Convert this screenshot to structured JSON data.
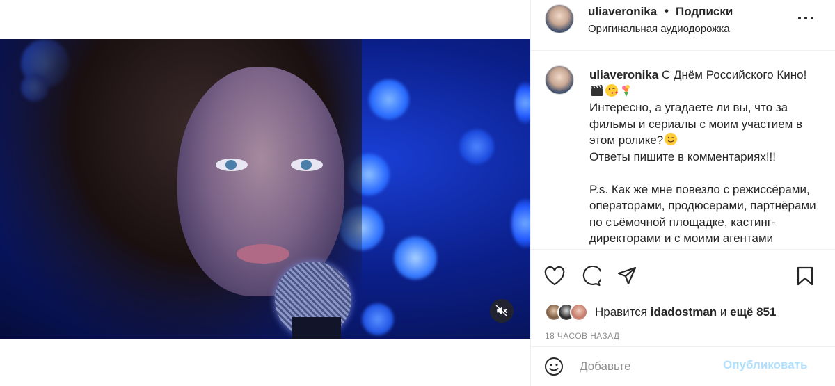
{
  "post": {
    "username": "uliaveronika",
    "dot": "•",
    "follow_label": "Подписки",
    "audio_label": "Оригинальная аудиодорожка",
    "caption": {
      "username": "uliaveronika",
      "line1": " С Днём Российского Кино!",
      "line2": "Интересно, а угадаете ли вы, что за фильмы и сериалы с моим участием в этом ролике?",
      "line3": "Ответы пишите в комментариях!!!",
      "line4": "P.s. Как же мне повезло с режиссёрами, операторами, продюсерами, партнёрами по съёмочной площадке, кастинг-директорами и с моими агентами"
    },
    "likes": {
      "prefix": "Нравится ",
      "user": "idadostman",
      "middle": " и ",
      "others": "ещё 851"
    },
    "time_ago": "18 часов назад"
  },
  "comment_bar": {
    "placeholder": "Добавьте",
    "publish_label": "Опубликовать"
  },
  "icons": {
    "more": "more-horizontal-icon",
    "like": "heart-icon",
    "comment": "comment-bubble-icon",
    "share": "paper-plane-icon",
    "save": "bookmark-icon",
    "mute": "speaker-muted-icon",
    "emoji": "smiley-icon"
  },
  "colors": {
    "text": "#262626",
    "muted": "#8e8e8e",
    "publish_disabled": "#b2dffc",
    "border": "#efefef",
    "video_blue": "#0b1f8a"
  }
}
